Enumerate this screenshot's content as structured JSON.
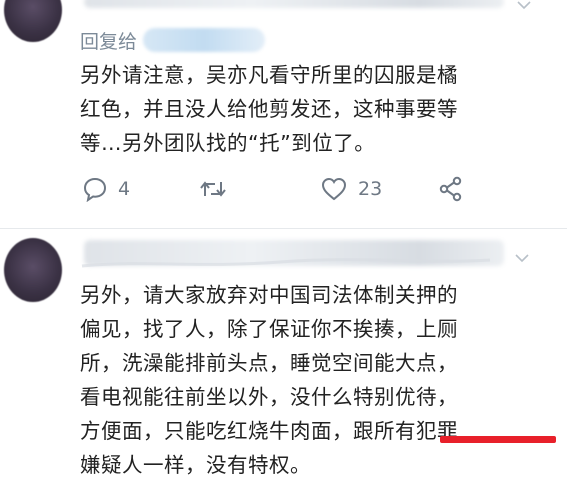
{
  "post1": {
    "reply_to_label": "回复给",
    "body_lines": [
      "另外请注意，吴亦凡看守所里的囚服是橘",
      "红色，并且没人给他剪发还，这种事要等",
      "等…另外团队找的“托”到位了。"
    ],
    "actions": {
      "reply_count": "4",
      "retweet_count": "",
      "like_count": "23"
    }
  },
  "post2": {
    "body_lines": [
      "另外，请大家放弃对中国司法体制关押的",
      "偏见，找了人，除了保证你不挨揍，上厕",
      "所，洗澡能排前头点，睡觉空间能大点，",
      "看电视能往前坐以外，没什么特别优待，",
      "方便面，只能吃红烧牛肉面，跟所有犯罪",
      "嫌疑人一样，没有特权。"
    ]
  },
  "colors": {
    "icon_gray": "#6e7884",
    "reply_gray": "#7c8a98",
    "annotation_red": "#e8202a"
  }
}
